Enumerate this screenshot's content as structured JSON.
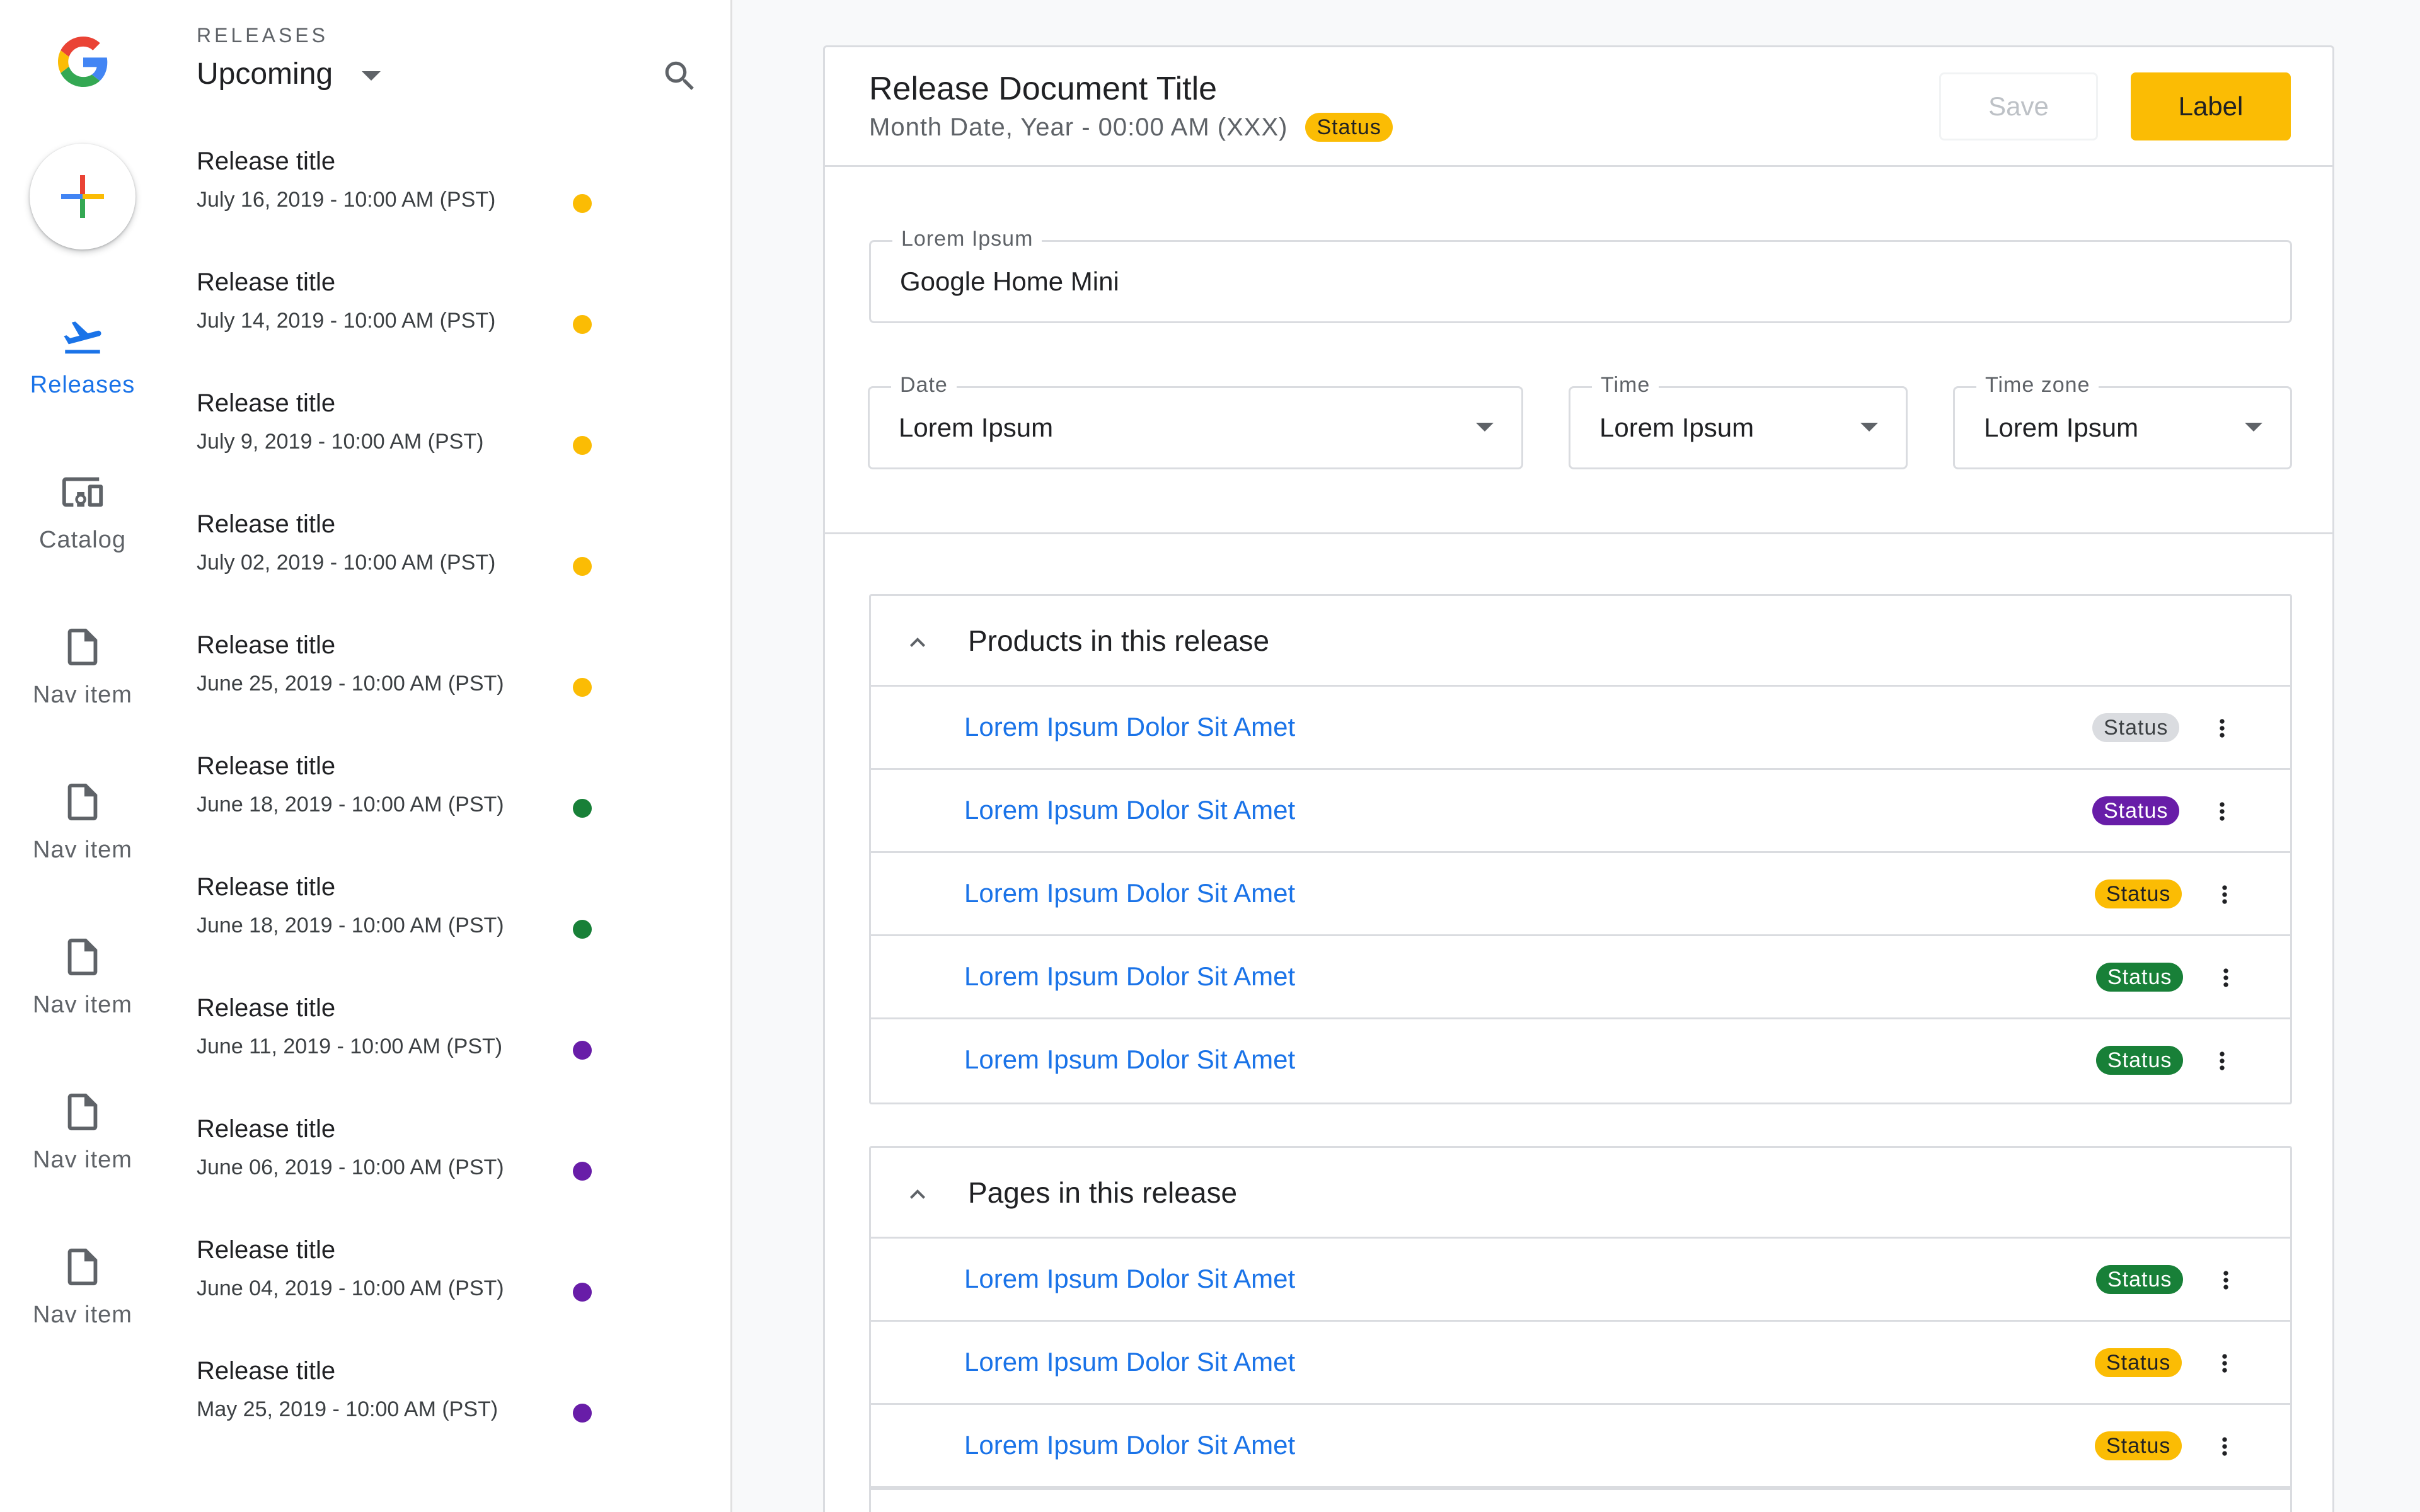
{
  "rail": {
    "items": [
      {
        "label": "Releases",
        "icon": "flight-takeoff-icon",
        "active": true
      },
      {
        "label": "Catalog",
        "icon": "devices-icon"
      },
      {
        "label": "Nav item",
        "icon": "document-icon"
      },
      {
        "label": "Nav item",
        "icon": "document-icon"
      },
      {
        "label": "Nav item",
        "icon": "document-icon"
      },
      {
        "label": "Nav item",
        "icon": "document-icon"
      },
      {
        "label": "Nav item",
        "icon": "document-icon"
      }
    ]
  },
  "list": {
    "section_label": "RELEASES",
    "filter_value": "Upcoming",
    "items": [
      {
        "title": "Release title",
        "date": "July 16, 2019 - 10:00 AM (PST)",
        "dot": "#fbbc04"
      },
      {
        "title": "Release title",
        "date": "July 14, 2019 - 10:00 AM (PST)",
        "dot": "#fbbc04"
      },
      {
        "title": "Release title",
        "date": "July 9, 2019 - 10:00 AM (PST)",
        "dot": "#fbbc04"
      },
      {
        "title": "Release title",
        "date": "July 02, 2019 - 10:00 AM (PST)",
        "dot": "#fbbc04"
      },
      {
        "title": "Release title",
        "date": "June 25, 2019 - 10:00 AM (PST)",
        "dot": "#fbbc04"
      },
      {
        "title": "Release title",
        "date": "June 18, 2019 - 10:00 AM (PST)",
        "dot": "#188038"
      },
      {
        "title": "Release title",
        "date": "June 18, 2019 - 10:00 AM (PST)",
        "dot": "#188038"
      },
      {
        "title": "Release title",
        "date": "June 11, 2019 - 10:00 AM (PST)",
        "dot": "#681da8"
      },
      {
        "title": "Release title",
        "date": "June 06, 2019 - 10:00 AM (PST)",
        "dot": "#681da8"
      },
      {
        "title": "Release title",
        "date": "June 04, 2019 - 10:00 AM (PST)",
        "dot": "#681da8"
      },
      {
        "title": "Release title",
        "date": "May 25, 2019 - 10:00 AM (PST)",
        "dot": "#681da8"
      }
    ]
  },
  "doc": {
    "title": "Release Document Title",
    "subtitle": "Month Date, Year - 00:00 AM (XXX)",
    "status": "Status",
    "save_label": "Save",
    "primary_label": "Label",
    "fields": {
      "name": {
        "label": "Lorem Ipsum",
        "value": "Google Home Mini"
      },
      "date": {
        "label": "Date",
        "value": "Lorem Ipsum"
      },
      "time": {
        "label": "Time",
        "value": "Lorem Ipsum"
      },
      "timezone": {
        "label": "Time zone",
        "value": "Lorem Ipsum"
      }
    }
  },
  "products": {
    "title": "Products in this release",
    "rows": [
      {
        "name": "Lorem Ipsum Dolor Sit Amet",
        "status": "Status",
        "status_color": "gray"
      },
      {
        "name": "Lorem Ipsum Dolor Sit Amet",
        "status": "Status",
        "status_color": "purple"
      },
      {
        "name": "Lorem Ipsum Dolor Sit Amet",
        "status": "Status",
        "status_color": "amber"
      },
      {
        "name": "Lorem Ipsum Dolor Sit Amet",
        "status": "Status",
        "status_color": "green"
      },
      {
        "name": "Lorem Ipsum Dolor Sit Amet",
        "status": "Status",
        "status_color": "green"
      }
    ]
  },
  "pages": {
    "title": "Pages in this release",
    "rows": [
      {
        "name": "Lorem Ipsum Dolor Sit Amet",
        "status": "Status",
        "status_color": "green"
      },
      {
        "name": "Lorem Ipsum Dolor Sit Amet",
        "status": "Status",
        "status_color": "amber"
      },
      {
        "name": "Lorem Ipsum Dolor Sit Amet",
        "status": "Status",
        "status_color": "amber"
      },
      {
        "name": "",
        "status": "",
        "status_color": "none"
      }
    ]
  }
}
